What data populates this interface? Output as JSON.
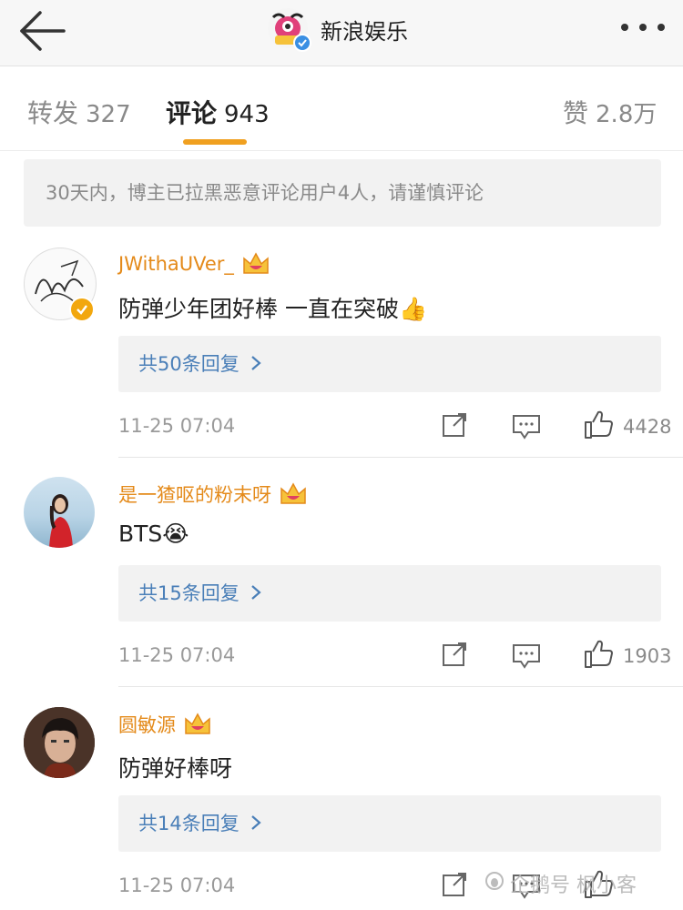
{
  "header": {
    "account_name": "新浪娱乐",
    "icons": {
      "back": "back-arrow-icon",
      "more": "more-dots-icon",
      "verified": "verified-check-icon"
    }
  },
  "tabs": [
    {
      "label": "转发",
      "count": "327"
    },
    {
      "label": "评论",
      "count": "943",
      "active": true
    },
    {
      "label": "赞",
      "count": "2.8万"
    }
  ],
  "notice": "30天内，博主已拉黑恶意评论用户4人，请谨慎评论",
  "comments": [
    {
      "username": "JWithaUVer_",
      "text": "防弹少年团好棒 一直在突破👍",
      "replies": "共50条回复",
      "time": "11-25 07:04",
      "likes": "4428",
      "verified": true
    },
    {
      "username": "是一猹呕的粉末呀",
      "text": "BTS😭",
      "replies": "共15条回复",
      "time": "11-25 07:04",
      "likes": "1903"
    },
    {
      "username": "圆敏源",
      "text": "防弹好棒呀",
      "replies": "共14条回复",
      "time": "11-25 07:04",
      "likes": ""
    }
  ],
  "watermark": "企鹅号 枫小客",
  "colors": {
    "accent": "#f0a020",
    "username": "#e48a1a",
    "link": "#4a7fb8",
    "badge": "#f2a70e"
  }
}
